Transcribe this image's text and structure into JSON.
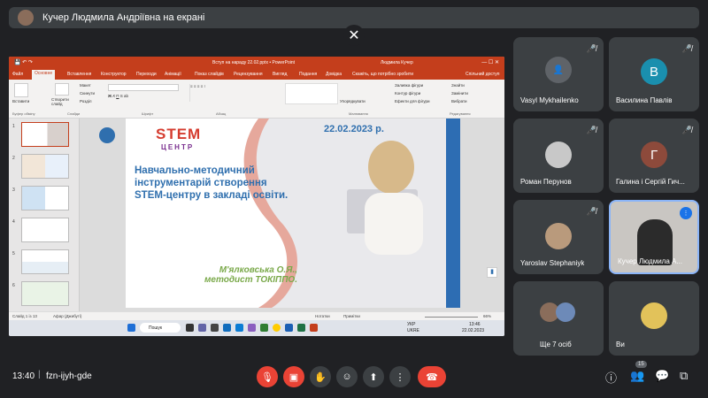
{
  "banner": {
    "text": "Кучер Людмила Андріївна на екрані"
  },
  "close_icon": "close-icon",
  "powerpoint": {
    "window_title": "Вступ на нараду 22.02.pptx  •  PowerPoint",
    "user_name": "Людмила Кучер",
    "menu": [
      "Файл",
      "Основне",
      "Вставлення",
      "Конструктор",
      "Переходи",
      "Анімації",
      "Показ слайдів",
      "Рецензування",
      "Вигляд",
      "Подання",
      "Довідка",
      "Скажіть, що потрібно зробити"
    ],
    "share_label": "Спільний доступ",
    "ribbon": {
      "paste": "Вставити",
      "new_slide": "Створити слайд",
      "layout": "Макет",
      "reset": "Скинути",
      "section": "Розділ",
      "arrange": "Упорядкувати",
      "find": "Знайти",
      "replace": "Замінити",
      "select": "Вибрати",
      "shape_fill": "Заливка фігури",
      "shape_outline": "Контур фігури",
      "shape_effects": "Ефекти для фігури",
      "groups": [
        "Буфер обміну",
        "Слайди",
        "Шрифт",
        "Абзац",
        "Малювання",
        "Редагування"
      ]
    },
    "slide_numbers": [
      "1",
      "2",
      "3",
      "4",
      "5",
      "6"
    ],
    "slide": {
      "logo_top": "STEM",
      "logo_bottom": "ЦЕНТР",
      "date": "22.02.2023 р.",
      "title_lines": [
        "Навчально-методичний",
        "інструментарій створення",
        "STEM-центру в закладі освіти."
      ],
      "author_line1": "М'ялковська О.Я.,",
      "author_line2": "методист ТОКІППО."
    },
    "status": {
      "slide_counter": "Слайд 1 із 13",
      "language": "Афар (Джибуті)",
      "notes": "Нотатки",
      "comments": "Примітки",
      "zoom": "66%"
    },
    "taskbar": {
      "search": "Пошук",
      "lang": "УКР",
      "lang2": "UKRE",
      "time": "13:46",
      "date": "22.02.2023"
    }
  },
  "participants": [
    {
      "name": "Vasyl Mykhailenko"
    },
    {
      "name": "Василина Павлів",
      "initial": "В",
      "color": "#1a8fae"
    },
    {
      "name": "Роман Перунов"
    },
    {
      "name": "Галина і Сергій Гич..."
    },
    {
      "name": "Yaroslav Stephaniyk"
    },
    {
      "name": "Кучер Людмила А..."
    },
    {
      "name": "Ще 7 осіб"
    },
    {
      "name": "Ви"
    }
  ],
  "second_row_initial": "Г",
  "second_row_color": "#8d4a3b",
  "meeting": {
    "time": "13:40",
    "code": "fzn-ijyh-gde",
    "participant_count": "15"
  },
  "colors": {
    "ppt_red": "#c43e1c",
    "meet_bg": "#202124",
    "tile_bg": "#3c4043",
    "end_call": "#ea4335"
  }
}
